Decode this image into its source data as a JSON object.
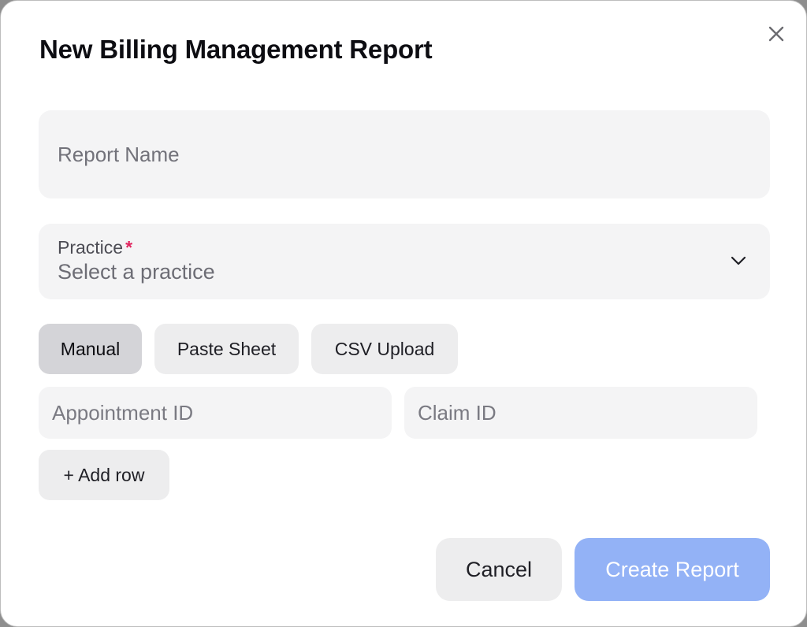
{
  "dialog": {
    "title": "New Billing Management Report",
    "close_icon": "close-icon"
  },
  "form": {
    "report_name": {
      "placeholder": "Report Name",
      "value": ""
    },
    "practice": {
      "label": "Practice",
      "required_marker": "*",
      "placeholder": "Select a practice",
      "chevron_icon": "chevron-down-icon"
    },
    "input_modes": [
      {
        "label": "Manual",
        "active": true
      },
      {
        "label": "Paste Sheet",
        "active": false
      },
      {
        "label": "CSV Upload",
        "active": false
      }
    ],
    "rows": {
      "appointment_id_placeholder": "Appointment ID",
      "claim_id_placeholder": "Claim ID"
    },
    "add_row_label": "+ Add row"
  },
  "footer": {
    "cancel_label": "Cancel",
    "create_label": "Create Report"
  },
  "colors": {
    "primary_disabled": "#93b2f6",
    "required": "#e0245e",
    "field_bg": "#f4f4f5",
    "tab_active_bg": "#d4d4d8"
  }
}
